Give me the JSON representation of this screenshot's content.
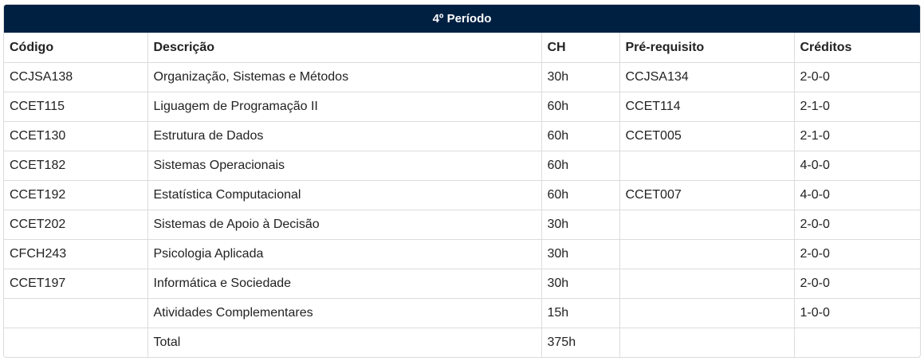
{
  "table": {
    "title": "4º Período",
    "headers": [
      "Código",
      "Descrição",
      "CH",
      "Pré-requisito",
      "Créditos"
    ],
    "rows": [
      {
        "codigo": "CCJSA138",
        "descricao": "Organização, Sistemas e Métodos",
        "ch": "30h",
        "prerequisito": "CCJSA134",
        "creditos": "2-0-0"
      },
      {
        "codigo": "CCET115",
        "descricao": "Liguagem de Programação II",
        "ch": "60h",
        "prerequisito": "CCET114",
        "creditos": "2-1-0"
      },
      {
        "codigo": "CCET130",
        "descricao": "Estrutura de Dados",
        "ch": "60h",
        "prerequisito": "CCET005",
        "creditos": "2-1-0"
      },
      {
        "codigo": "CCET182",
        "descricao": "Sistemas Operacionais",
        "ch": "60h",
        "prerequisito": "",
        "creditos": "4-0-0"
      },
      {
        "codigo": "CCET192",
        "descricao": "Estatística Computacional",
        "ch": "60h",
        "prerequisito": "CCET007",
        "creditos": "4-0-0"
      },
      {
        "codigo": "CCET202",
        "descricao": "Sistemas de Apoio à Decisão",
        "ch": "30h",
        "prerequisito": "",
        "creditos": "2-0-0"
      },
      {
        "codigo": "CFCH243",
        "descricao": "Psicologia Aplicada",
        "ch": "30h",
        "prerequisito": "",
        "creditos": "2-0-0"
      },
      {
        "codigo": "CCET197",
        "descricao": "Informática e Sociedade",
        "ch": "30h",
        "prerequisito": "",
        "creditos": "2-0-0"
      },
      {
        "codigo": "",
        "descricao": "Atividades Complementares",
        "ch": "15h",
        "prerequisito": "",
        "creditos": "1-0-0"
      },
      {
        "codigo": "",
        "descricao": "Total",
        "ch": "375h",
        "prerequisito": "",
        "creditos": ""
      }
    ]
  },
  "colors": {
    "header_bg": "#002042",
    "header_text": "#ffffff",
    "border": "#dcdcdc"
  }
}
